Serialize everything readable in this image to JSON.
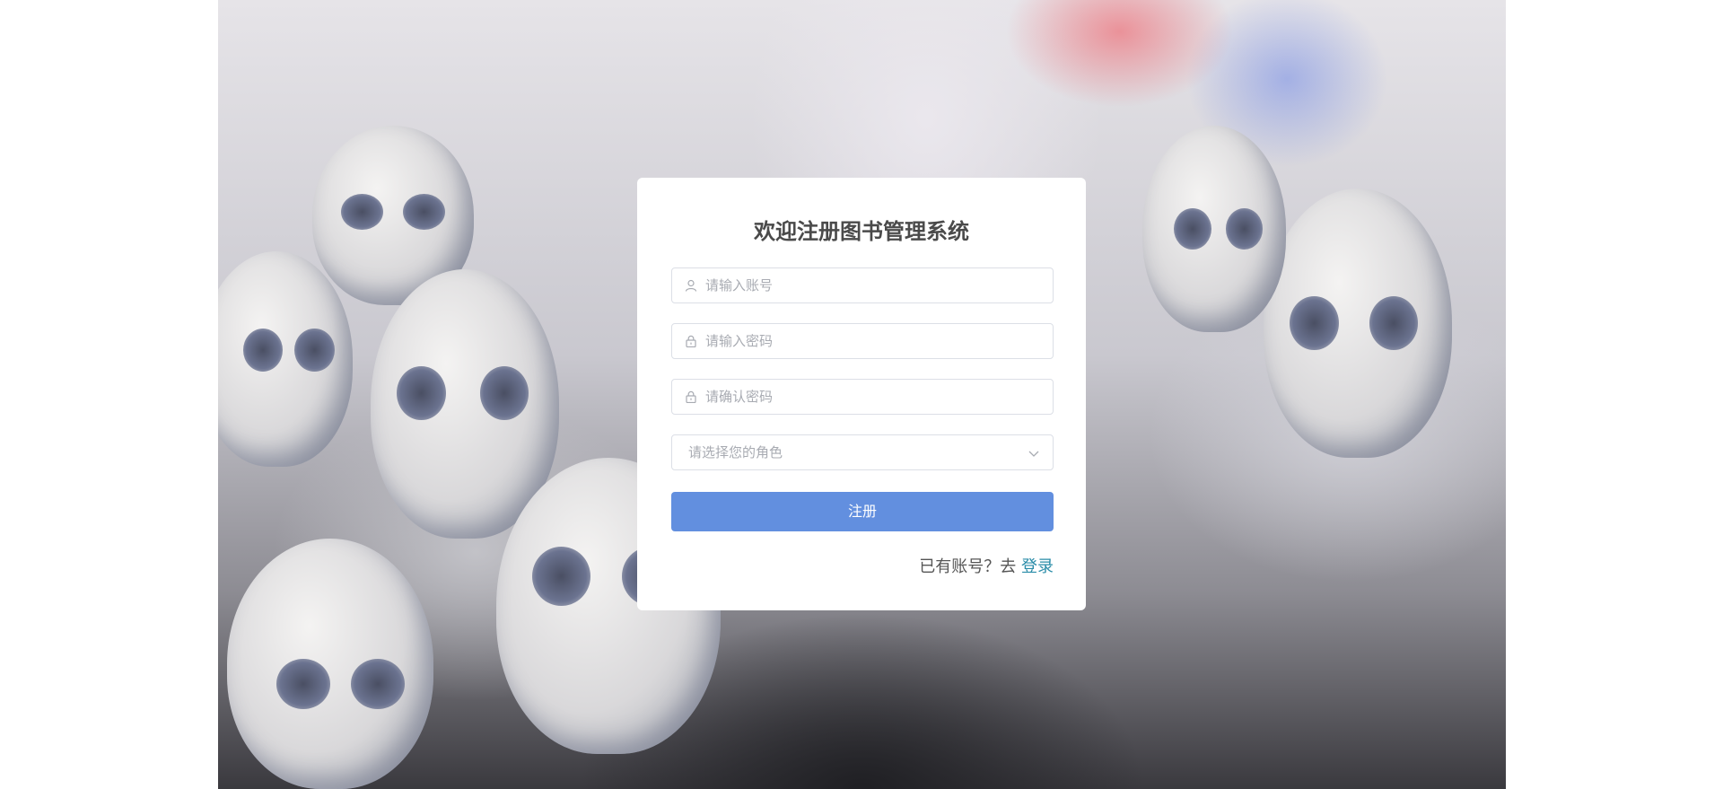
{
  "form": {
    "title": "欢迎注册图书管理系统",
    "username_placeholder": "请输入账号",
    "password_placeholder": "请输入密码",
    "confirm_placeholder": "请确认密码",
    "role_placeholder": "请选择您的角色",
    "submit_label": "注册",
    "footer_prefix": "已有账号？去",
    "login_link": "登录"
  },
  "icons": {
    "username": "user-icon",
    "password": "lock-icon",
    "confirm": "lock-icon",
    "role": "chevron-down-icon"
  },
  "colors": {
    "primary_button": "#628fdf",
    "link": "#2a8ca8",
    "title": "#4a4a4a",
    "placeholder": "#a8abb2"
  }
}
